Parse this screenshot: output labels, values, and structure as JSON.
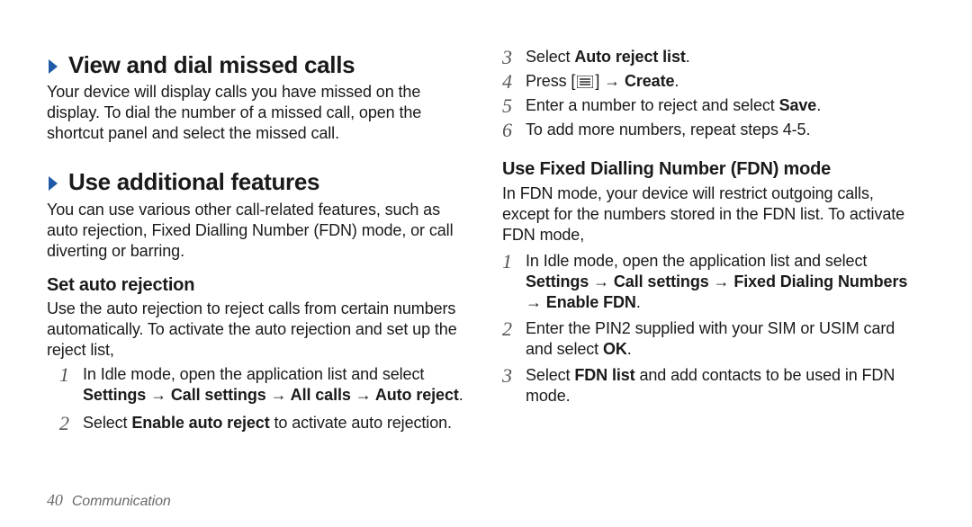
{
  "left": {
    "h_view": "View and dial missed calls",
    "p_view": "Your device will display calls you have missed on the display. To dial the number of a missed call, open the shortcut panel and select the missed call.",
    "h_use": "Use additional features",
    "p_use": "You can use various other call-related features, such as auto rejection, Fixed Dialling Number (FDN) mode, or call diverting or barring.",
    "h_auto": "Set auto rejection",
    "p_auto": "Use the auto rejection to reject calls from certain numbers automatically. To activate the auto rejection and set up the reject list,",
    "step1_a": "In Idle mode, open the application list and select ",
    "step1_b": "Settings → Call settings → All calls → Auto reject",
    "step2_a": "Select ",
    "step2_b": "Enable auto reject",
    "step2_c": " to activate auto rejection."
  },
  "right": {
    "step3_a": "Select ",
    "step3_b": "Auto reject list",
    "step4_a": "Press [",
    "step4_b": "] → ",
    "step4_c": "Create",
    "step5_a": "Enter a number to reject and select ",
    "step5_b": "Save",
    "step6": "To add more numbers, repeat steps 4-5.",
    "h_fdn": "Use Fixed Dialling Number (FDN) mode",
    "p_fdn": "In FDN mode, your device will restrict outgoing calls, except for the numbers stored in the FDN list. To activate FDN mode,",
    "f1_a": "In Idle mode, open the application list and select ",
    "f1_b": "Settings → Call settings → Fixed Dialing Numbers → Enable FDN",
    "f2_a": "Enter the PIN2 supplied with your SIM or USIM card and select ",
    "f2_b": "OK",
    "f3_a": "Select ",
    "f3_b": "FDN list",
    "f3_c": " and add contacts to be used in FDN mode."
  },
  "nums": {
    "n1": "1",
    "n2": "2",
    "n3": "3",
    "n4": "4",
    "n5": "5",
    "n6": "6"
  },
  "footer": {
    "page": "40",
    "section": "Communication"
  },
  "period": "."
}
